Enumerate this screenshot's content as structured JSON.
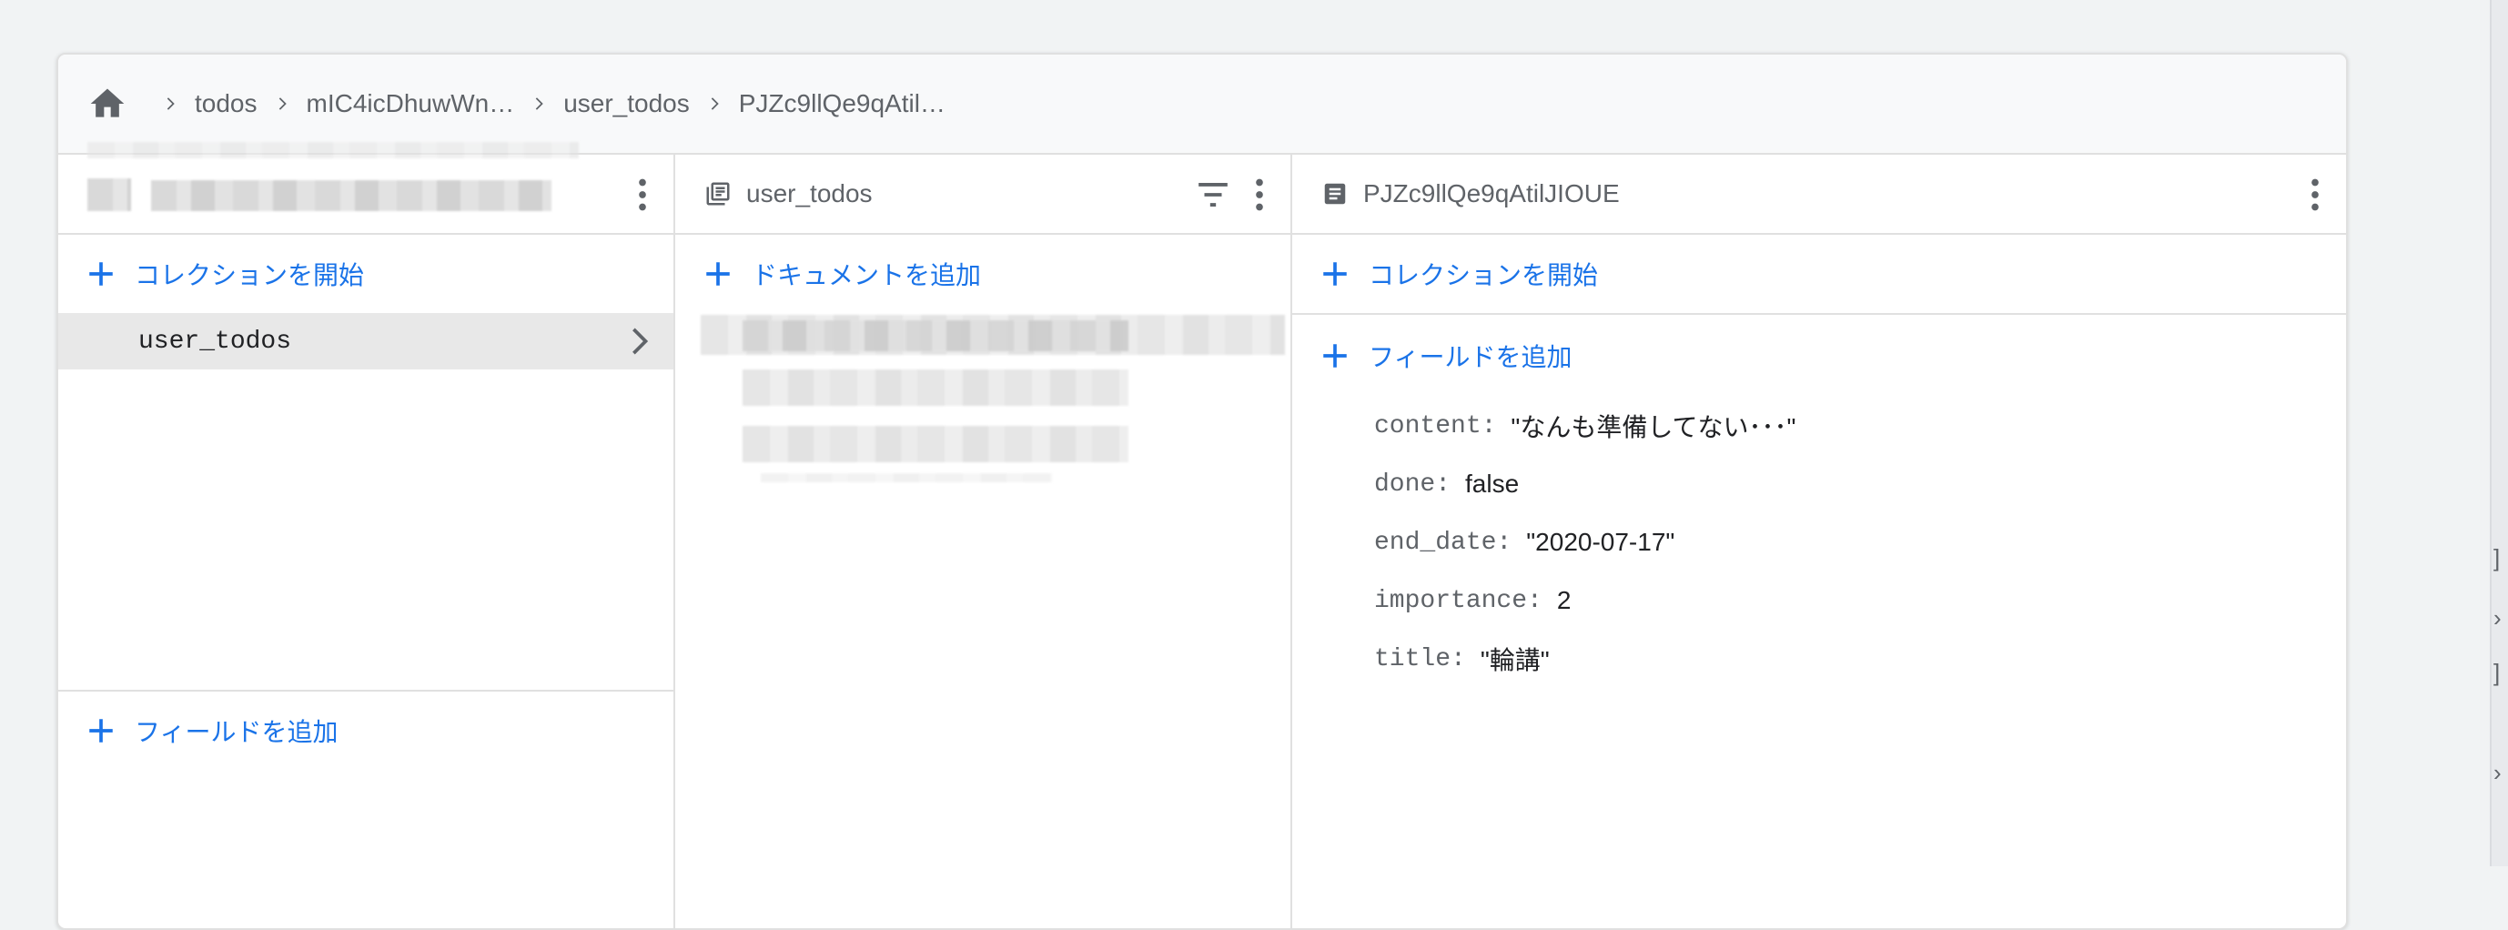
{
  "breadcrumb": {
    "items": [
      "todos",
      "mIC4icDhuwWn…",
      "user_todos",
      "PJZc9llQe9qAtil…"
    ]
  },
  "col1": {
    "start_collection": "コレクションを開始",
    "collection_item": "user_todos",
    "add_field": "フィールドを追加"
  },
  "col2": {
    "title": "user_todos",
    "add_document": "ドキュメントを追加"
  },
  "col3": {
    "title": "PJZc9llQe9qAtilJIOUE",
    "start_collection": "コレクションを開始",
    "add_field": "フィールドを追加",
    "fields": [
      {
        "key": "content:",
        "value": "\"なんも準備してない･･･\""
      },
      {
        "key": "done:",
        "value": "false"
      },
      {
        "key": "end_date:",
        "value": "\"2020-07-17\""
      },
      {
        "key": "importance:",
        "value": "2"
      },
      {
        "key": "title:",
        "value": "\"輪講\""
      }
    ]
  },
  "colors": {
    "accent": "#1a73e8",
    "icon": "#5f6368",
    "selected_bg": "#e8e8e8"
  },
  "icons": {
    "home": "home-icon",
    "breadcrumb_separator": "chevron-right-icon",
    "collection": "collection-icon",
    "document": "document-icon",
    "filter": "filter-icon",
    "more": "more-vert-icon",
    "add": "plus-icon"
  }
}
